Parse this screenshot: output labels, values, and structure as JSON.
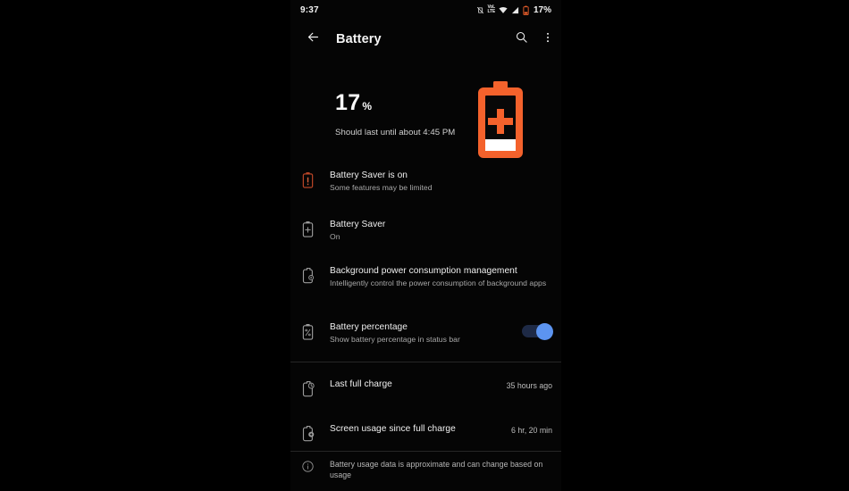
{
  "colors": {
    "accent_orange": "#f4622c",
    "toggle_thumb": "#5c94f0",
    "toggle_track": "#1e2a46",
    "background": "#050505",
    "letterbox": "#000000",
    "divider": "#262626",
    "alert_icon": "#b64426"
  },
  "status_bar": {
    "time": "9:37",
    "battery_percent": "17%",
    "icons": [
      "vibrate-off-icon",
      "volte-icon",
      "wifi-icon",
      "signal-icon",
      "battery-low-icon"
    ],
    "volte_top": "VoL",
    "volte_bottom": "LTE"
  },
  "app_bar": {
    "back_icon": "back-arrow-icon",
    "title": "Battery",
    "search_icon": "search-icon",
    "overflow_icon": "more-vertical-icon"
  },
  "hero": {
    "percent": "17",
    "percent_unit": "%",
    "subtitle": "Should last until about 4:45 PM",
    "graphic": "battery-plus-graphic"
  },
  "rows": [
    {
      "icon": "battery-alert-icon",
      "title": "Battery Saver is on",
      "subtitle": "Some features may be limited",
      "value": "",
      "has_toggle": false
    },
    {
      "icon": "battery-plus-icon",
      "title": "Battery Saver",
      "subtitle": "On",
      "value": "",
      "has_toggle": false
    },
    {
      "icon": "battery-settings-icon",
      "title": "Background power consumption management",
      "subtitle": "Intelligently control the power consumption of background apps",
      "value": "",
      "has_toggle": false
    },
    {
      "icon": "battery-percent-icon",
      "title": "Battery percentage",
      "subtitle": "Show battery percentage in status bar",
      "value": "",
      "has_toggle": true,
      "toggle_state": "on"
    },
    {
      "icon": "battery-clock-icon",
      "title": "Last full charge",
      "subtitle": "",
      "value": "35 hours ago",
      "has_toggle": false
    },
    {
      "icon": "battery-screen-icon",
      "title": "Screen usage since full charge",
      "subtitle": "",
      "value": "6 hr, 20 min",
      "has_toggle": false
    }
  ],
  "footer": {
    "icon": "info-icon",
    "text": "Battery usage data is approximate and can change based on usage"
  }
}
